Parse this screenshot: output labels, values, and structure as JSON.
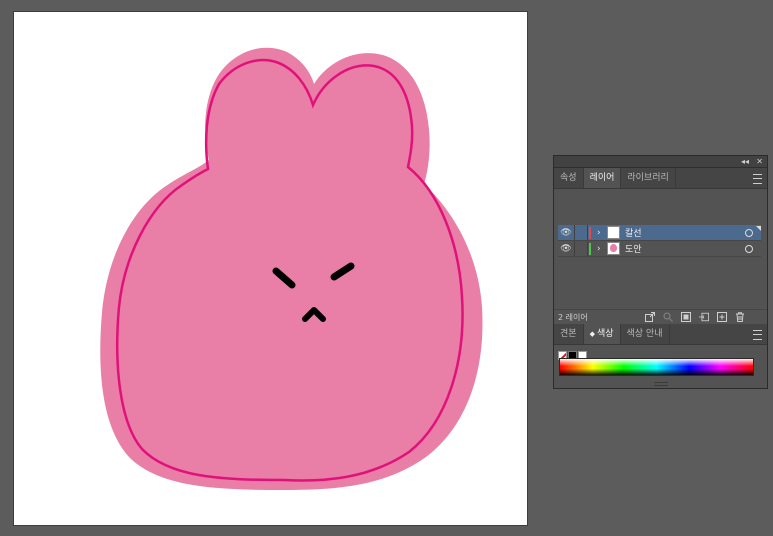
{
  "canvas": {
    "background": "#5c5c5c",
    "artboard_color": "#ffffff",
    "illustration": {
      "fill_color": "#e97ea6",
      "stroke_color": "#e0127a",
      "feature_color": "#000000"
    }
  },
  "panel": {
    "top_controls": {
      "collapse": "◂◂",
      "close": "✕"
    },
    "tabs": [
      {
        "label": "속성"
      },
      {
        "label": "레이어"
      },
      {
        "label": "라이브러리"
      }
    ],
    "active_tab": "레이어",
    "layers": [
      {
        "name": "칼선",
        "color": "#e2484f",
        "visible_icon": "eye-icon",
        "selected": true
      },
      {
        "name": "도안",
        "color": "#4ec34e",
        "visible_icon": "eye-icon",
        "selected": false
      }
    ],
    "layer_count": "2 레이어",
    "footer_icons": [
      "export-icon",
      "search-icon",
      "clipping-mask-icon",
      "new-sublayer-icon",
      "new-layer-icon",
      "trash-icon"
    ]
  },
  "color_panel": {
    "tabs": [
      {
        "label": "견본"
      },
      {
        "label": "색상",
        "prefix": "◆"
      },
      {
        "label": "색상 안내"
      }
    ],
    "active_tab": "색상",
    "swatches": [
      "none",
      "black",
      "white"
    ],
    "spectrum": "rainbow"
  }
}
